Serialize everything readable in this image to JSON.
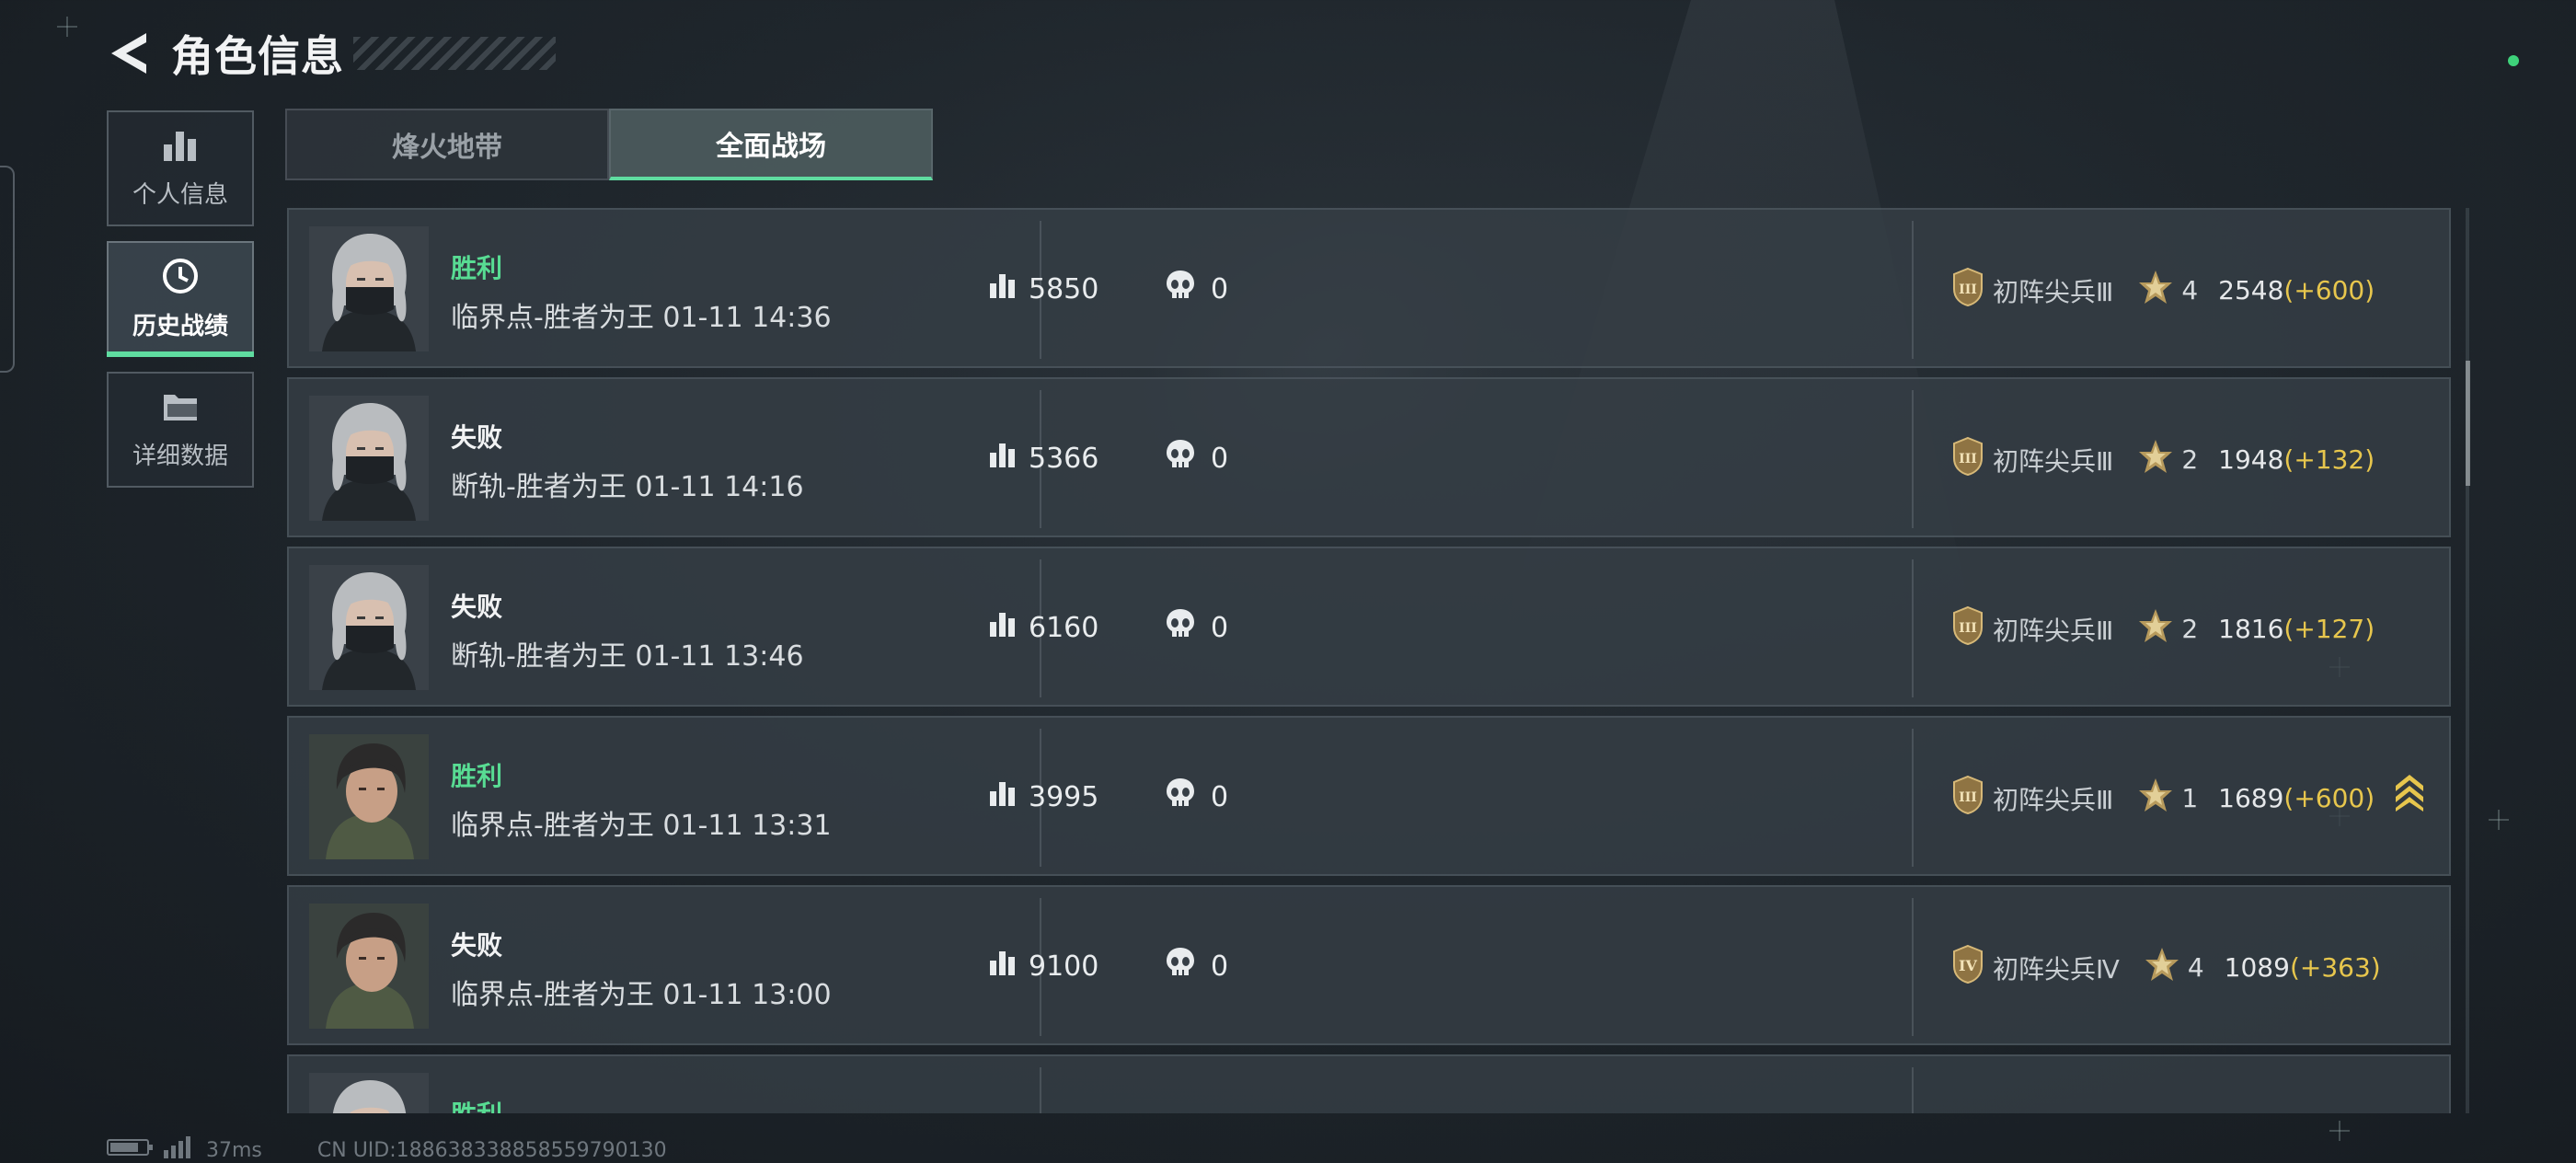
{
  "header": {
    "title": "角色信息"
  },
  "sidebar": {
    "items": [
      {
        "label": "个人信息",
        "icon": "bar-chart-icon",
        "active": false
      },
      {
        "label": "历史战绩",
        "icon": "clock-icon",
        "active": true
      },
      {
        "label": "详细数据",
        "icon": "folder-icon",
        "active": false
      }
    ]
  },
  "tabs": [
    {
      "label": "烽火地带",
      "active": false
    },
    {
      "label": "全面战场",
      "active": true
    }
  ],
  "matches": [
    {
      "result": "胜利",
      "result_type": "win",
      "info": "临界点-胜者为王 01-11 14:36",
      "score": "5850",
      "kills": "0",
      "rank_name": "初阵尖兵Ⅲ",
      "rank_numeral": "III",
      "stars": "4",
      "points": "2548",
      "delta": "(+600)",
      "avatar": "silver-hair"
    },
    {
      "result": "失败",
      "result_type": "lose",
      "info": "断轨-胜者为王 01-11 14:16",
      "score": "5366",
      "kills": "0",
      "rank_name": "初阵尖兵Ⅲ",
      "rank_numeral": "III",
      "stars": "2",
      "points": "1948",
      "delta": "(+132)",
      "avatar": "silver-hair"
    },
    {
      "result": "失败",
      "result_type": "lose",
      "info": "断轨-胜者为王 01-11 13:46",
      "score": "6160",
      "kills": "0",
      "rank_name": "初阵尖兵Ⅲ",
      "rank_numeral": "III",
      "stars": "2",
      "points": "1816",
      "delta": "(+127)",
      "avatar": "silver-hair"
    },
    {
      "result": "胜利",
      "result_type": "win",
      "info": "临界点-胜者为王 01-11 13:31",
      "score": "3995",
      "kills": "0",
      "rank_name": "初阵尖兵Ⅲ",
      "rank_numeral": "III",
      "stars": "1",
      "points": "1689",
      "delta": "(+600)",
      "avatar": "dark-hair",
      "promoted": true
    },
    {
      "result": "失败",
      "result_type": "lose",
      "info": "临界点-胜者为王 01-11 13:00",
      "score": "9100",
      "kills": "0",
      "rank_name": "初阵尖兵Ⅳ",
      "rank_numeral": "IV",
      "stars": "4",
      "points": "1089",
      "delta": "(+363)",
      "avatar": "dark-hair"
    },
    {
      "result": "胜利",
      "result_type": "win",
      "info": "",
      "score": "",
      "kills": "",
      "rank_name": "",
      "rank_numeral": "",
      "stars": "",
      "points": "",
      "delta": "",
      "avatar": "silver-hair",
      "partial": true
    }
  ],
  "footer": {
    "ping": "37ms",
    "uid": "CN UID:188638338858559790130"
  },
  "colors": {
    "win": "#58dc93",
    "accent": "#5fdca0",
    "delta": "#e7c64d",
    "rank_gold": "#c8a860"
  }
}
